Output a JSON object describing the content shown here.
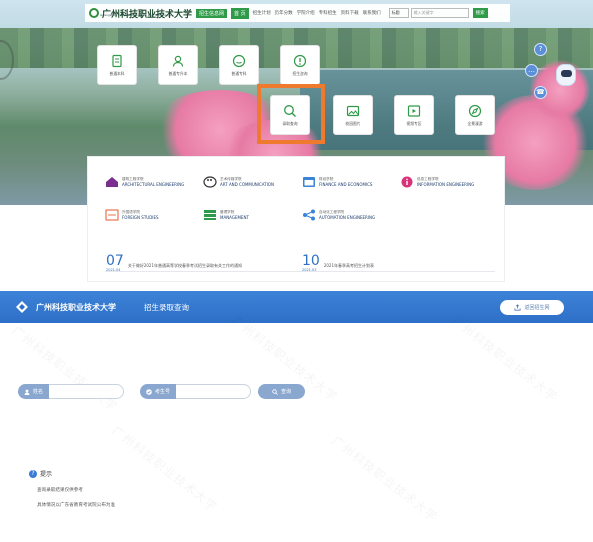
{
  "portal": {
    "brand_name": "广州科技职业技术大学",
    "brand_en": "Guangzhou Institute of Science and Technology",
    "admission_badge": "招生信息网",
    "home_label": "首 页",
    "nav": [
      "招生计划",
      "历年分数",
      "学院介绍",
      "专科招生",
      "资料下载",
      "联系我们"
    ],
    "search_select": "标题",
    "search_placeholder": "输入关键字",
    "search_button": "搜索",
    "tiles": [
      {
        "label": "普通本科",
        "icon": "document-icon"
      },
      {
        "label": "普通专升本",
        "icon": "user-icon"
      },
      {
        "label": "普通专科",
        "icon": "chat-icon"
      },
      {
        "label": "招生咨询",
        "icon": "alert-icon"
      },
      {
        "label": "录取查询",
        "icon": "search-icon"
      },
      {
        "label": "校园图片",
        "icon": "image-icon"
      },
      {
        "label": "视频专区",
        "icon": "video-icon"
      },
      {
        "label": "全景漫游",
        "icon": "compass-icon"
      }
    ],
    "colleges": [
      {
        "name_cn": "建筑工程学院",
        "name_en": "ARCHITECTURAL ENGINEERING",
        "color": "#7a2f8f"
      },
      {
        "name_cn": "艺术传媒学院",
        "name_en": "ART AND COMMUNICATION",
        "color": "#333333"
      },
      {
        "name_cn": "财经学院",
        "name_en": "FINANCE AND ECONOMICS",
        "color": "#3a84d6"
      },
      {
        "name_cn": "信息工程学院",
        "name_en": "INFORMATION ENGINEERING",
        "color": "#d8337a"
      },
      {
        "name_cn": "外国语学院",
        "name_en": "FOREIGN STUDIES",
        "color": "#e9734f"
      },
      {
        "name_cn": "管理学院",
        "name_en": "MANAGEMENT",
        "color": "#2f9a48"
      },
      {
        "name_cn": "自动化工程学院",
        "name_en": "AUTOMATION ENGINEERING",
        "color": "#3a84d6"
      }
    ],
    "news": [
      {
        "day": "07",
        "ym": "2021.04",
        "title": "关于做好2021年普通高等学校春季考试招生录取有关工作的通知"
      },
      {
        "day": "10",
        "ym": "2021.03",
        "title": "2021年春季高考招生计划表"
      }
    ]
  },
  "query_page": {
    "university_name": "广州科技职业技术大学",
    "system_title": "招生录取查询",
    "back_button": "返回招生网",
    "fields": [
      {
        "label": "姓名",
        "icon": "person-icon",
        "value": ""
      },
      {
        "label": "考生号",
        "icon": "check-icon",
        "value": ""
      }
    ],
    "query_button": "查询",
    "tips_title": "提示",
    "tips": [
      "查询录取结果仅供参考",
      "具体情况以广东省教育考试院公布为准"
    ],
    "watermark": "广州科技职业技术大学"
  },
  "colors": {
    "primary_blue": "#2e6fc7",
    "green": "#2f9a48",
    "highlight_orange": "#ef7a2d"
  }
}
